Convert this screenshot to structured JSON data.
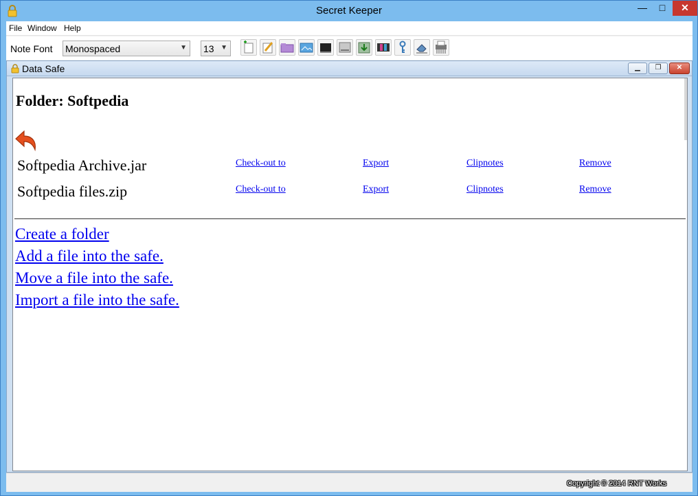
{
  "window": {
    "title": "Secret Keeper",
    "min_glyph": "—",
    "max_glyph": "□",
    "close_glyph": "✕"
  },
  "menu": [
    "File",
    "Window",
    "Help"
  ],
  "toolbar": {
    "font_label": "Note Font",
    "font_value": "Monospaced",
    "size_value": "13",
    "tools": [
      "new-note-icon",
      "edit-note-icon",
      "folder-icon",
      "image-icon",
      "terminal-icon",
      "drive-icon",
      "download-icon",
      "film-icon",
      "key-icon",
      "eraser-icon",
      "shredder-icon"
    ]
  },
  "frame": {
    "title": "Data Safe",
    "min_glyph": "▁",
    "max_glyph": "❐",
    "close_glyph": "✕"
  },
  "content": {
    "folder_heading": "Folder: Softpedia",
    "files": [
      {
        "name": "Softpedia Archive.jar",
        "checkout": "Check-out to",
        "export": "Export",
        "clipnotes": "Clipnotes",
        "remove": "Remove"
      },
      {
        "name": "Softpedia files.zip",
        "checkout": "Check-out to",
        "export": "Export",
        "clipnotes": "Clipnotes",
        "remove": "Remove"
      }
    ],
    "actions": [
      "Create a folder",
      "Add a file into the safe.",
      "Move a file into the safe.",
      "Import a file into the safe."
    ]
  },
  "status": {
    "copyright": "Copyright © 2014 RNT Works"
  },
  "colors": {
    "title_bg": "#7cbcee",
    "link": "#0000ee",
    "close_red": "#c7372f"
  }
}
